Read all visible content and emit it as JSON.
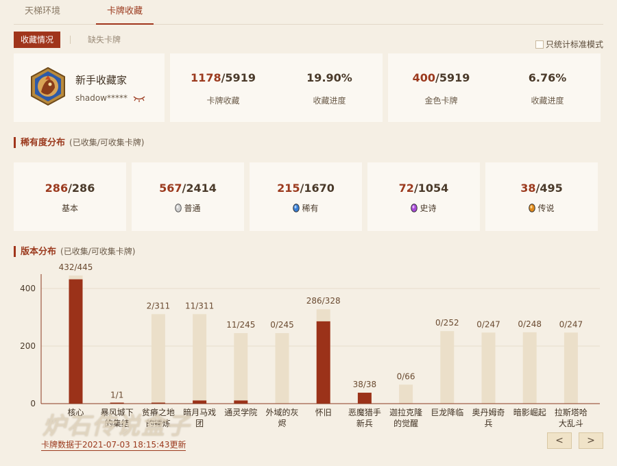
{
  "tabs": [
    {
      "label": "天梯环境",
      "active": false
    },
    {
      "label": "卡牌收藏",
      "active": true
    }
  ],
  "subtabs": {
    "active": "收藏情况",
    "other": "缺失卡牌"
  },
  "standard_mode": {
    "label": "只统计标准模式",
    "checked": false
  },
  "profile": {
    "title": "新手收藏家",
    "username": "shadow*****"
  },
  "collection": {
    "cards": {
      "owned": "1178",
      "total": "/5919",
      "label": "卡牌收藏"
    },
    "cards_progress": {
      "value": "19.90%",
      "label": "收藏进度"
    },
    "golden": {
      "owned": "400",
      "total": "/5919",
      "label": "金色卡牌"
    },
    "golden_progress": {
      "value": "6.76%",
      "label": "收藏进度"
    }
  },
  "rarity_section": {
    "title": "稀有度分布",
    "note": "(已收集/可收集卡牌)"
  },
  "rarity": [
    {
      "owned": "286",
      "total": "/286",
      "label": "基本",
      "gem": null
    },
    {
      "owned": "567",
      "total": "/2414",
      "label": "普通",
      "gem": "#b8b8b8"
    },
    {
      "owned": "215",
      "total": "/1670",
      "label": "稀有",
      "gem": "#3a7fd5"
    },
    {
      "owned": "72",
      "total": "/1054",
      "label": "史诗",
      "gem": "#a84ad8"
    },
    {
      "owned": "38",
      "total": "/495",
      "label": "传说",
      "gem": "#e08a1c"
    }
  ],
  "set_section": {
    "title": "版本分布",
    "note": "(已收集/可收集卡牌)"
  },
  "chart_data": {
    "type": "bar",
    "categories": [
      "核心",
      "暴风城下的集结",
      "贫瘠之地的锤炼",
      "暗月马戏团",
      "通灵学院",
      "外域的灰烬",
      "怀旧",
      "恶魔猎手新兵",
      "迦拉克隆的觉醒",
      "巨龙降临",
      "奥丹姆奇兵",
      "暗影崛起",
      "拉斯塔哈大乱斗"
    ],
    "category_lines": [
      [
        "核心"
      ],
      [
        "暴风城下",
        "的集结"
      ],
      [
        "贫瘠之地",
        "的锤炼"
      ],
      [
        "暗月马戏",
        "团"
      ],
      [
        "通灵学院"
      ],
      [
        "外域的灰",
        "烬"
      ],
      [
        "怀旧"
      ],
      [
        "恶魔猎手",
        "新兵"
      ],
      [
        "迦拉克隆",
        "的觉醒"
      ],
      [
        "巨龙降临"
      ],
      [
        "奥丹姆奇",
        "兵"
      ],
      [
        "暗影崛起"
      ],
      [
        "拉斯塔哈",
        "大乱斗"
      ]
    ],
    "series": [
      {
        "name": "",
        "values": [
          432,
          1,
          2,
          11,
          11,
          0,
          286,
          38,
          0,
          0,
          0,
          0,
          0
        ]
      },
      {
        "name": "",
        "values": [
          445,
          1,
          311,
          311,
          245,
          245,
          328,
          38,
          66,
          252,
          247,
          248,
          247
        ]
      }
    ],
    "labels": [
      "432/445",
      "1/1",
      "2/311",
      "11/311",
      "11/245",
      "0/245",
      "286/328",
      "38/38",
      "0/66",
      "0/252",
      "0/247",
      "0/248",
      "0/247"
    ],
    "yticks": [
      0,
      200,
      400
    ],
    "ylim": [
      0,
      450
    ],
    "grid": true,
    "colors": {
      "owned": "#9b3219",
      "total": "#ebdfc9"
    }
  },
  "watermark": "炉石传说盒子",
  "updated_text": "卡牌数据于2021-07-03 18:15:43更新",
  "pager": {
    "prev": "<",
    "next": ">"
  }
}
